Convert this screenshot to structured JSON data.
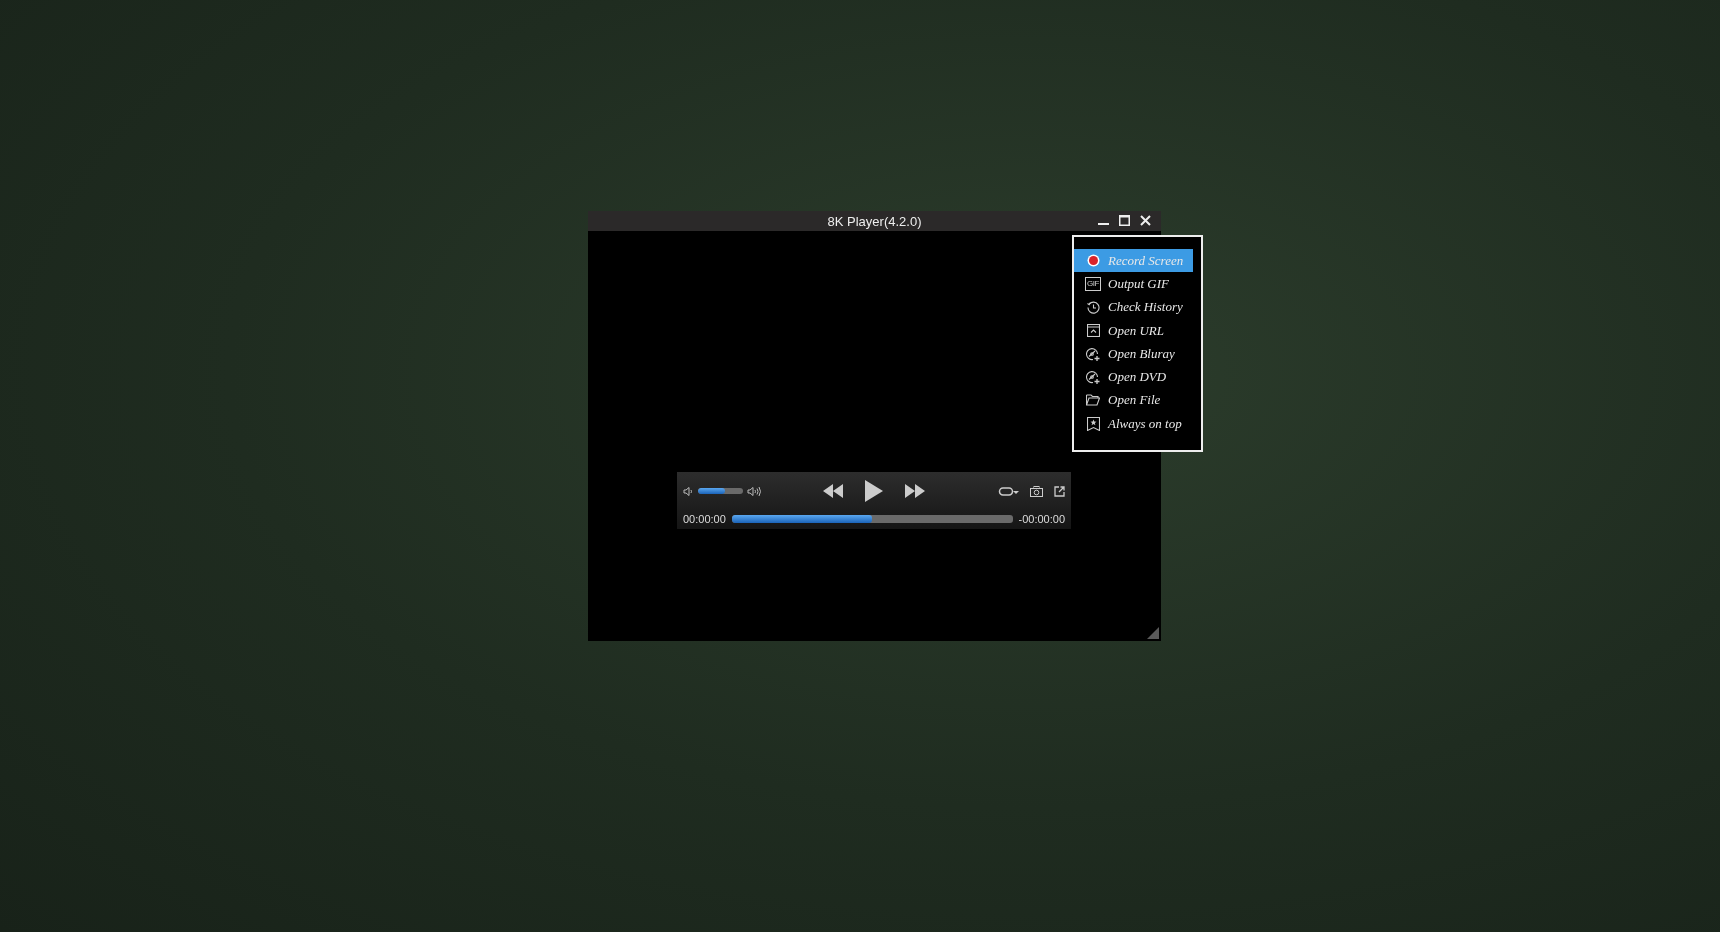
{
  "window": {
    "title": "8K Player(4.2.0)"
  },
  "player": {
    "volume": {
      "level": 0.6
    },
    "progress": {
      "level": 0.5
    },
    "elapsed": "00:00:00",
    "remaining": "-00:00:00"
  },
  "menu": {
    "items": [
      {
        "label": "Record Screen",
        "kind": "record",
        "selected": true
      },
      {
        "label": "Output GIF",
        "kind": "gif",
        "badge": "GIF",
        "selected": false
      },
      {
        "label": "Check History",
        "kind": "history",
        "selected": false
      },
      {
        "label": "Open URL",
        "kind": "url",
        "selected": false
      },
      {
        "label": "Open Bluray",
        "kind": "disc",
        "selected": false
      },
      {
        "label": "Open DVD",
        "kind": "disc",
        "selected": false
      },
      {
        "label": "Open File",
        "kind": "folder",
        "selected": false
      },
      {
        "label": "Always on top",
        "kind": "pin",
        "selected": false
      }
    ]
  }
}
